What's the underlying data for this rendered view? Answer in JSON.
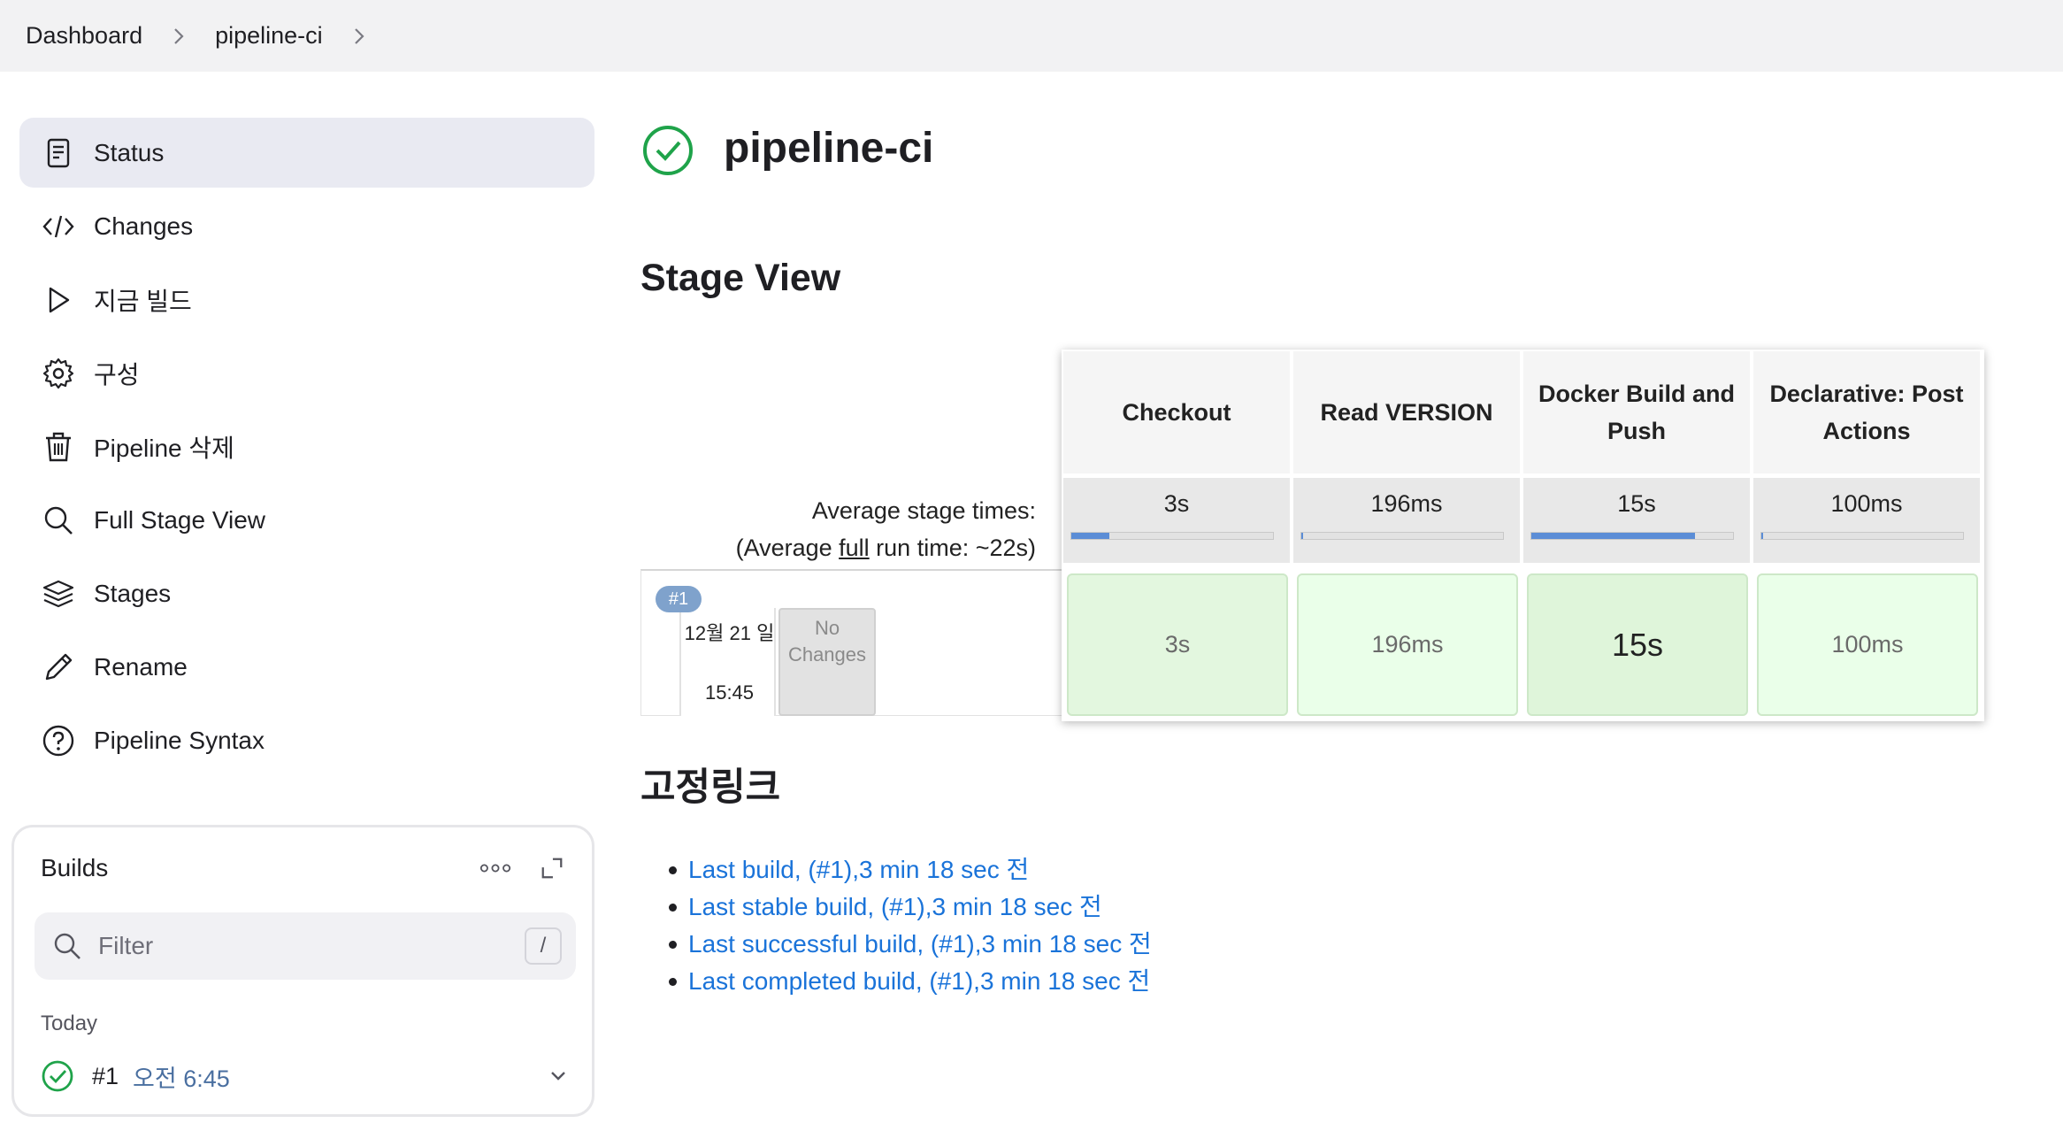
{
  "breadcrumb": [
    "Dashboard",
    "pipeline-ci"
  ],
  "sidebar": {
    "items": [
      {
        "label": "Status",
        "icon": "document-icon",
        "active": true
      },
      {
        "label": "Changes",
        "icon": "code-icon"
      },
      {
        "label": "지금 빌드",
        "icon": "play-icon"
      },
      {
        "label": "구성",
        "icon": "gear-icon"
      },
      {
        "label": "Pipeline 삭제",
        "icon": "trash-icon"
      },
      {
        "label": "Full Stage View",
        "icon": "search-icon"
      },
      {
        "label": "Stages",
        "icon": "layers-icon"
      },
      {
        "label": "Rename",
        "icon": "pencil-icon"
      },
      {
        "label": "Pipeline Syntax",
        "icon": "help-icon"
      }
    ]
  },
  "builds": {
    "title": "Builds",
    "filter_placeholder": "Filter",
    "shortcut": "/",
    "group_label": "Today",
    "items": [
      {
        "number": "#1",
        "time": "오전 6:45",
        "status": "success"
      }
    ]
  },
  "main": {
    "title": "pipeline-ci",
    "status": "success"
  },
  "stage_view": {
    "title": "Stage View",
    "avg_label_1": "Average stage times:",
    "avg_label_2_prefix": "(Average ",
    "avg_label_2_link": "full",
    "avg_label_2_suffix": " run time: ~22s)",
    "stages": [
      {
        "name": "Checkout",
        "avg": "3s",
        "avg_fraction": 0.19,
        "cell": "3s"
      },
      {
        "name": "Read VERSION",
        "avg": "196ms",
        "avg_fraction": 0.01,
        "cell": "196ms"
      },
      {
        "name": "Docker Build and Push",
        "avg": "15s",
        "avg_fraction": 0.81,
        "cell": "15s"
      },
      {
        "name": "Declarative: Post Actions",
        "avg": "100ms",
        "avg_fraction": 0.01,
        "cell": "100ms"
      }
    ],
    "build": {
      "badge": "#1",
      "date": "12월 21 일",
      "time": "15:45",
      "changes": "No Changes"
    }
  },
  "permalinks": {
    "title": "고정링크",
    "links": [
      "Last build, (#1),3 min 18 sec 전",
      "Last stable build, (#1),3 min 18 sec 전",
      "Last successful build, (#1),3 min 18 sec 전",
      "Last completed build, (#1),3 min 18 sec 전"
    ]
  },
  "colors": {
    "success": "#1fa34a",
    "link": "#1a73d9",
    "stage_bar": "#5b8dd6",
    "active_nav": "#e9eaf2"
  }
}
